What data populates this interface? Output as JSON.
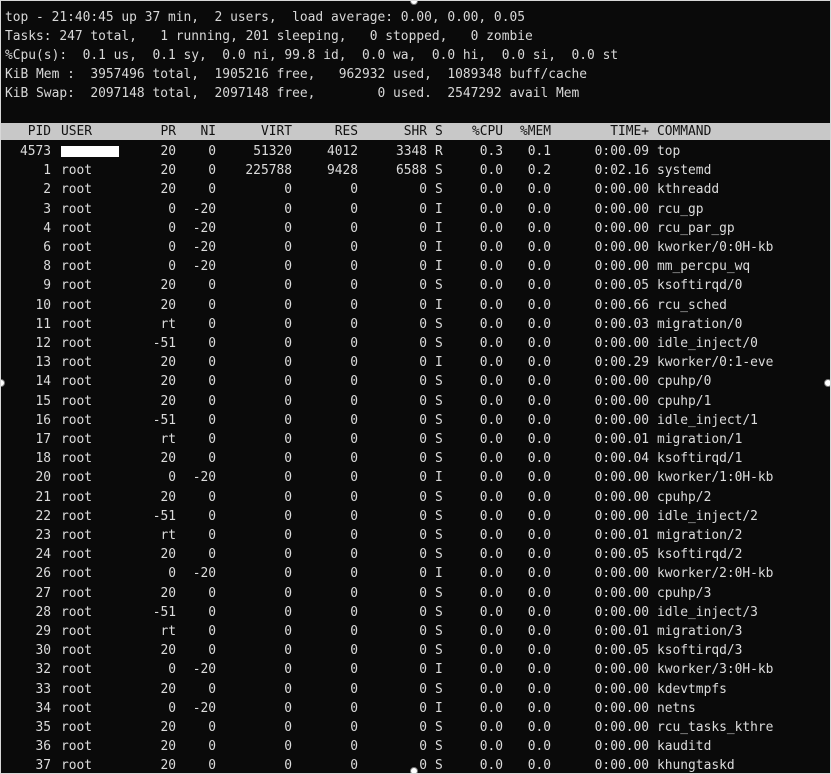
{
  "summary": {
    "line_top": "top - 21:40:45 up 37 min,  2 users,  load average: 0.00, 0.00, 0.05",
    "line_tasks": "Tasks: 247 total,   1 running, 201 sleeping,   0 stopped,   0 zombie",
    "line_cpu": "%Cpu(s):  0.1 us,  0.1 sy,  0.0 ni, 99.8 id,  0.0 wa,  0.0 hi,  0.0 si,  0.0 st",
    "line_mem": "KiB Mem :  3957496 total,  1905216 free,   962932 used,  1089348 buff/cache",
    "line_swap": "KiB Swap:  2097148 total,  2097148 free,        0 used.  2547292 avail Mem"
  },
  "columns": {
    "pid": "PID",
    "user": "USER",
    "pr": "PR",
    "ni": "NI",
    "virt": "VIRT",
    "res": "RES",
    "shr": "SHR",
    "s": "S",
    "cpu": "%CPU",
    "mem": "%MEM",
    "time": "TIME+",
    "command": "COMMAND"
  },
  "processes": [
    {
      "pid": "4573",
      "user": "",
      "user_redacted": true,
      "pr": "20",
      "ni": "0",
      "virt": "51320",
      "res": "4012",
      "shr": "3348",
      "s": "R",
      "cpu": "0.3",
      "mem": "0.1",
      "time": "0:00.09",
      "command": "top"
    },
    {
      "pid": "1",
      "user": "root",
      "pr": "20",
      "ni": "0",
      "virt": "225788",
      "res": "9428",
      "shr": "6588",
      "s": "S",
      "cpu": "0.0",
      "mem": "0.2",
      "time": "0:02.16",
      "command": "systemd"
    },
    {
      "pid": "2",
      "user": "root",
      "pr": "20",
      "ni": "0",
      "virt": "0",
      "res": "0",
      "shr": "0",
      "s": "S",
      "cpu": "0.0",
      "mem": "0.0",
      "time": "0:00.00",
      "command": "kthreadd"
    },
    {
      "pid": "3",
      "user": "root",
      "pr": "0",
      "ni": "-20",
      "virt": "0",
      "res": "0",
      "shr": "0",
      "s": "I",
      "cpu": "0.0",
      "mem": "0.0",
      "time": "0:00.00",
      "command": "rcu_gp"
    },
    {
      "pid": "4",
      "user": "root",
      "pr": "0",
      "ni": "-20",
      "virt": "0",
      "res": "0",
      "shr": "0",
      "s": "I",
      "cpu": "0.0",
      "mem": "0.0",
      "time": "0:00.00",
      "command": "rcu_par_gp"
    },
    {
      "pid": "6",
      "user": "root",
      "pr": "0",
      "ni": "-20",
      "virt": "0",
      "res": "0",
      "shr": "0",
      "s": "I",
      "cpu": "0.0",
      "mem": "0.0",
      "time": "0:00.00",
      "command": "kworker/0:0H-kb"
    },
    {
      "pid": "8",
      "user": "root",
      "pr": "0",
      "ni": "-20",
      "virt": "0",
      "res": "0",
      "shr": "0",
      "s": "I",
      "cpu": "0.0",
      "mem": "0.0",
      "time": "0:00.00",
      "command": "mm_percpu_wq"
    },
    {
      "pid": "9",
      "user": "root",
      "pr": "20",
      "ni": "0",
      "virt": "0",
      "res": "0",
      "shr": "0",
      "s": "S",
      "cpu": "0.0",
      "mem": "0.0",
      "time": "0:00.05",
      "command": "ksoftirqd/0"
    },
    {
      "pid": "10",
      "user": "root",
      "pr": "20",
      "ni": "0",
      "virt": "0",
      "res": "0",
      "shr": "0",
      "s": "I",
      "cpu": "0.0",
      "mem": "0.0",
      "time": "0:00.66",
      "command": "rcu_sched"
    },
    {
      "pid": "11",
      "user": "root",
      "pr": "rt",
      "ni": "0",
      "virt": "0",
      "res": "0",
      "shr": "0",
      "s": "S",
      "cpu": "0.0",
      "mem": "0.0",
      "time": "0:00.03",
      "command": "migration/0"
    },
    {
      "pid": "12",
      "user": "root",
      "pr": "-51",
      "ni": "0",
      "virt": "0",
      "res": "0",
      "shr": "0",
      "s": "S",
      "cpu": "0.0",
      "mem": "0.0",
      "time": "0:00.00",
      "command": "idle_inject/0"
    },
    {
      "pid": "13",
      "user": "root",
      "pr": "20",
      "ni": "0",
      "virt": "0",
      "res": "0",
      "shr": "0",
      "s": "I",
      "cpu": "0.0",
      "mem": "0.0",
      "time": "0:00.29",
      "command": "kworker/0:1-eve"
    },
    {
      "pid": "14",
      "user": "root",
      "pr": "20",
      "ni": "0",
      "virt": "0",
      "res": "0",
      "shr": "0",
      "s": "S",
      "cpu": "0.0",
      "mem": "0.0",
      "time": "0:00.00",
      "command": "cpuhp/0"
    },
    {
      "pid": "15",
      "user": "root",
      "pr": "20",
      "ni": "0",
      "virt": "0",
      "res": "0",
      "shr": "0",
      "s": "S",
      "cpu": "0.0",
      "mem": "0.0",
      "time": "0:00.00",
      "command": "cpuhp/1"
    },
    {
      "pid": "16",
      "user": "root",
      "pr": "-51",
      "ni": "0",
      "virt": "0",
      "res": "0",
      "shr": "0",
      "s": "S",
      "cpu": "0.0",
      "mem": "0.0",
      "time": "0:00.00",
      "command": "idle_inject/1"
    },
    {
      "pid": "17",
      "user": "root",
      "pr": "rt",
      "ni": "0",
      "virt": "0",
      "res": "0",
      "shr": "0",
      "s": "S",
      "cpu": "0.0",
      "mem": "0.0",
      "time": "0:00.01",
      "command": "migration/1"
    },
    {
      "pid": "18",
      "user": "root",
      "pr": "20",
      "ni": "0",
      "virt": "0",
      "res": "0",
      "shr": "0",
      "s": "S",
      "cpu": "0.0",
      "mem": "0.0",
      "time": "0:00.04",
      "command": "ksoftirqd/1"
    },
    {
      "pid": "20",
      "user": "root",
      "pr": "0",
      "ni": "-20",
      "virt": "0",
      "res": "0",
      "shr": "0",
      "s": "I",
      "cpu": "0.0",
      "mem": "0.0",
      "time": "0:00.00",
      "command": "kworker/1:0H-kb"
    },
    {
      "pid": "21",
      "user": "root",
      "pr": "20",
      "ni": "0",
      "virt": "0",
      "res": "0",
      "shr": "0",
      "s": "S",
      "cpu": "0.0",
      "mem": "0.0",
      "time": "0:00.00",
      "command": "cpuhp/2"
    },
    {
      "pid": "22",
      "user": "root",
      "pr": "-51",
      "ni": "0",
      "virt": "0",
      "res": "0",
      "shr": "0",
      "s": "S",
      "cpu": "0.0",
      "mem": "0.0",
      "time": "0:00.00",
      "command": "idle_inject/2"
    },
    {
      "pid": "23",
      "user": "root",
      "pr": "rt",
      "ni": "0",
      "virt": "0",
      "res": "0",
      "shr": "0",
      "s": "S",
      "cpu": "0.0",
      "mem": "0.0",
      "time": "0:00.01",
      "command": "migration/2"
    },
    {
      "pid": "24",
      "user": "root",
      "pr": "20",
      "ni": "0",
      "virt": "0",
      "res": "0",
      "shr": "0",
      "s": "S",
      "cpu": "0.0",
      "mem": "0.0",
      "time": "0:00.05",
      "command": "ksoftirqd/2"
    },
    {
      "pid": "26",
      "user": "root",
      "pr": "0",
      "ni": "-20",
      "virt": "0",
      "res": "0",
      "shr": "0",
      "s": "I",
      "cpu": "0.0",
      "mem": "0.0",
      "time": "0:00.00",
      "command": "kworker/2:0H-kb"
    },
    {
      "pid": "27",
      "user": "root",
      "pr": "20",
      "ni": "0",
      "virt": "0",
      "res": "0",
      "shr": "0",
      "s": "S",
      "cpu": "0.0",
      "mem": "0.0",
      "time": "0:00.00",
      "command": "cpuhp/3"
    },
    {
      "pid": "28",
      "user": "root",
      "pr": "-51",
      "ni": "0",
      "virt": "0",
      "res": "0",
      "shr": "0",
      "s": "S",
      "cpu": "0.0",
      "mem": "0.0",
      "time": "0:00.00",
      "command": "idle_inject/3"
    },
    {
      "pid": "29",
      "user": "root",
      "pr": "rt",
      "ni": "0",
      "virt": "0",
      "res": "0",
      "shr": "0",
      "s": "S",
      "cpu": "0.0",
      "mem": "0.0",
      "time": "0:00.01",
      "command": "migration/3"
    },
    {
      "pid": "30",
      "user": "root",
      "pr": "20",
      "ni": "0",
      "virt": "0",
      "res": "0",
      "shr": "0",
      "s": "S",
      "cpu": "0.0",
      "mem": "0.0",
      "time": "0:00.05",
      "command": "ksoftirqd/3"
    },
    {
      "pid": "32",
      "user": "root",
      "pr": "0",
      "ni": "-20",
      "virt": "0",
      "res": "0",
      "shr": "0",
      "s": "I",
      "cpu": "0.0",
      "mem": "0.0",
      "time": "0:00.00",
      "command": "kworker/3:0H-kb"
    },
    {
      "pid": "33",
      "user": "root",
      "pr": "20",
      "ni": "0",
      "virt": "0",
      "res": "0",
      "shr": "0",
      "s": "S",
      "cpu": "0.0",
      "mem": "0.0",
      "time": "0:00.00",
      "command": "kdevtmpfs"
    },
    {
      "pid": "34",
      "user": "root",
      "pr": "0",
      "ni": "-20",
      "virt": "0",
      "res": "0",
      "shr": "0",
      "s": "I",
      "cpu": "0.0",
      "mem": "0.0",
      "time": "0:00.00",
      "command": "netns"
    },
    {
      "pid": "35",
      "user": "root",
      "pr": "20",
      "ni": "0",
      "virt": "0",
      "res": "0",
      "shr": "0",
      "s": "S",
      "cpu": "0.0",
      "mem": "0.0",
      "time": "0:00.00",
      "command": "rcu_tasks_kthre"
    },
    {
      "pid": "36",
      "user": "root",
      "pr": "20",
      "ni": "0",
      "virt": "0",
      "res": "0",
      "shr": "0",
      "s": "S",
      "cpu": "0.0",
      "mem": "0.0",
      "time": "0:00.00",
      "command": "kauditd"
    },
    {
      "pid": "37",
      "user": "root",
      "pr": "20",
      "ni": "0",
      "virt": "0",
      "res": "0",
      "shr": "0",
      "s": "S",
      "cpu": "0.0",
      "mem": "0.0",
      "time": "0:00.00",
      "command": "khungtaskd"
    }
  ]
}
